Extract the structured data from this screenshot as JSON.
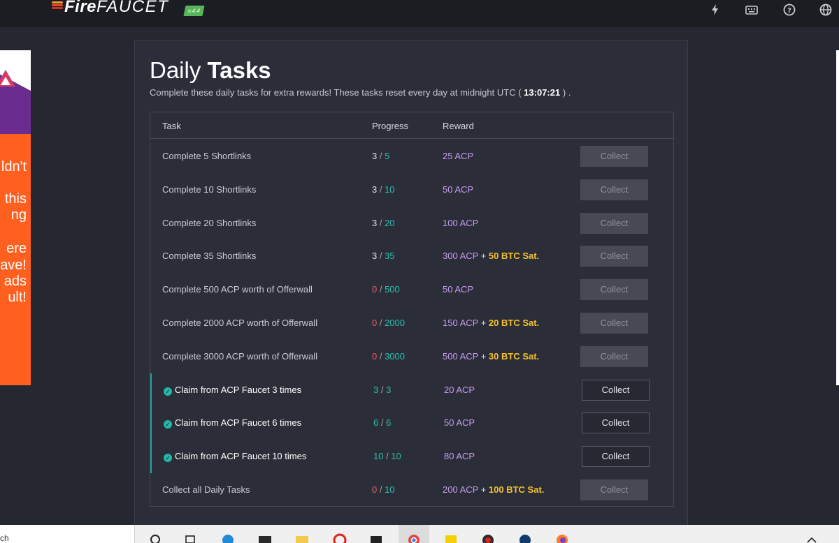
{
  "brand": {
    "name_part1": "Fire",
    "name_part2": "FAUCET",
    "version": "v.4.4"
  },
  "nav_icons": [
    "lightning-icon",
    "keyboard-icon",
    "help-icon",
    "globe-icon"
  ],
  "ad": {
    "lines": [
      "ldn't",
      "this",
      "ng",
      "ere",
      "ave!",
      "ads",
      "ult!"
    ]
  },
  "page": {
    "title_light": "Daily",
    "title_bold": "Tasks",
    "subtitle_pre": "Complete these daily tasks for extra rewards! These tasks reset every day at midnight UTC (",
    "reset_time": "13:07:21",
    "subtitle_post": ") ."
  },
  "table": {
    "headers": {
      "task": "Task",
      "progress": "Progress",
      "reward": "Reward"
    },
    "rows": [
      {
        "task": "Complete 5 Shortlinks",
        "have": "3",
        "need": "5",
        "acp": "25 ACP",
        "btc": "",
        "button": "Collect",
        "completed": false,
        "collectable": false
      },
      {
        "task": "Complete 10 Shortlinks",
        "have": "3",
        "need": "10",
        "acp": "50 ACP",
        "btc": "",
        "button": "Collect",
        "completed": false,
        "collectable": false
      },
      {
        "task": "Complete 20 Shortlinks",
        "have": "3",
        "need": "20",
        "acp": "100 ACP",
        "btc": "",
        "button": "Collect",
        "completed": false,
        "collectable": false
      },
      {
        "task": "Complete 35 Shortlinks",
        "have": "3",
        "need": "35",
        "acp": "300 ACP",
        "btc": "50 BTC Sat.",
        "button": "Collect",
        "completed": false,
        "collectable": false
      },
      {
        "task": "Complete 500 ACP worth of Offerwall",
        "have": "0",
        "need": "500",
        "acp": "50 ACP",
        "btc": "",
        "button": "Collect",
        "completed": false,
        "collectable": false
      },
      {
        "task": "Complete 2000 ACP worth of Offerwall",
        "have": "0",
        "need": "2000",
        "acp": "150 ACP",
        "btc": "20 BTC Sat.",
        "button": "Collect",
        "completed": false,
        "collectable": false
      },
      {
        "task": "Complete 3000 ACP worth of Offerwall",
        "have": "0",
        "need": "3000",
        "acp": "500 ACP",
        "btc": "30 BTC Sat.",
        "button": "Collect",
        "completed": false,
        "collectable": false
      },
      {
        "task": "Claim from ACP Faucet 3 times",
        "have": "3",
        "need": "3",
        "acp": "20 ACP",
        "btc": "",
        "button": "Collect",
        "completed": true,
        "collectable": true
      },
      {
        "task": "Claim from ACP Faucet 6 times",
        "have": "6",
        "need": "6",
        "acp": "50 ACP",
        "btc": "",
        "button": "Collect",
        "completed": true,
        "collectable": true
      },
      {
        "task": "Claim from ACP Faucet 10 times",
        "have": "10",
        "need": "10",
        "acp": "80 ACP",
        "btc": "",
        "button": "Collect",
        "completed": true,
        "collectable": true
      },
      {
        "task": "Collect all Daily Tasks",
        "have": "0",
        "need": "10",
        "acp": "200 ACP",
        "btc": "100 BTC Sat.",
        "button": "Collect",
        "completed": false,
        "collectable": false
      }
    ]
  },
  "taskbar": {
    "search_fragment": "ch"
  },
  "colors": {
    "acp": "#c89af0",
    "btc": "#f4c02c",
    "teal": "#2bbfb0",
    "zero": "#f35a5a"
  }
}
